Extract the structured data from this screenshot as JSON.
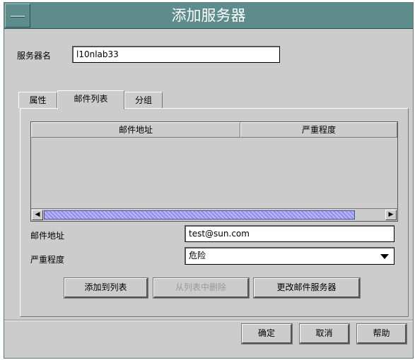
{
  "window": {
    "title": "添加服务器"
  },
  "server": {
    "label": "服务器名",
    "value": "l10nlab33"
  },
  "tabs": [
    {
      "label": "属性"
    },
    {
      "label": "邮件列表"
    },
    {
      "label": "分组"
    }
  ],
  "table": {
    "columns": [
      "邮件地址",
      "严重程度"
    ],
    "rows": []
  },
  "form": {
    "email_label": "邮件地址",
    "email_value": "test@sun.com",
    "severity_label": "严重程度",
    "severity_value": "危险"
  },
  "actions": {
    "add": "添加到列表",
    "remove": "从列表中删除",
    "change": "更改邮件服务器"
  },
  "footer": {
    "ok": "确定",
    "cancel": "取消",
    "help": "帮助"
  },
  "colors": {
    "titlebar": "#5e8c8a",
    "scroll_thumb": "#9090ea",
    "window_bg": "#cccccc"
  }
}
